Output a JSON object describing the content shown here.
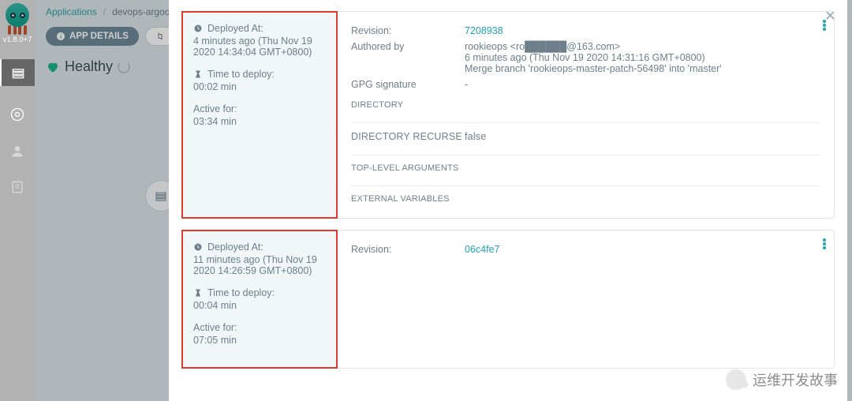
{
  "version": "v1.8.0+7",
  "breadcrumb": {
    "root": "Applications",
    "current": "devops-argocd-test"
  },
  "toolbar": {
    "details": "APP DETAILS",
    "diff": "APP DIFF"
  },
  "health": {
    "label": "Healthy"
  },
  "labels": {
    "deployed_at": "Deployed At:",
    "time_to_deploy": "Time to deploy:",
    "active_for": "Active for:",
    "revision": "Revision:",
    "authored_by": "Authored by",
    "gpg": "GPG signature",
    "directory": "DIRECTORY",
    "dir_recurse": "DIRECTORY RECURSE",
    "top_args": "TOP-LEVEL ARGUMENTS",
    "ext_vars": "EXTERNAL VARIABLES"
  },
  "entries": [
    {
      "deployed_at": "4 minutes ago (Thu Nov 19 2020 14:34:04 GMT+0800)",
      "time_to_deploy": "00:02 min",
      "active_for": "03:34 min",
      "revision": "7208938",
      "author": "rookieops <ro██████@163.com>",
      "author_time": "6 minutes ago (Thu Nov 19 2020 14:31:16 GMT+0800)",
      "message": "Merge branch 'rookieops-master-patch-56498' into 'master'",
      "gpg": "-",
      "dir_recurse": "false"
    },
    {
      "deployed_at": "11 minutes ago (Thu Nov 19 2020 14:26:59 GMT+0800)",
      "time_to_deploy": "00:04 min",
      "active_for": "07:05 min",
      "revision": "06c4fe7"
    }
  ],
  "watermark": "运维开发故事"
}
